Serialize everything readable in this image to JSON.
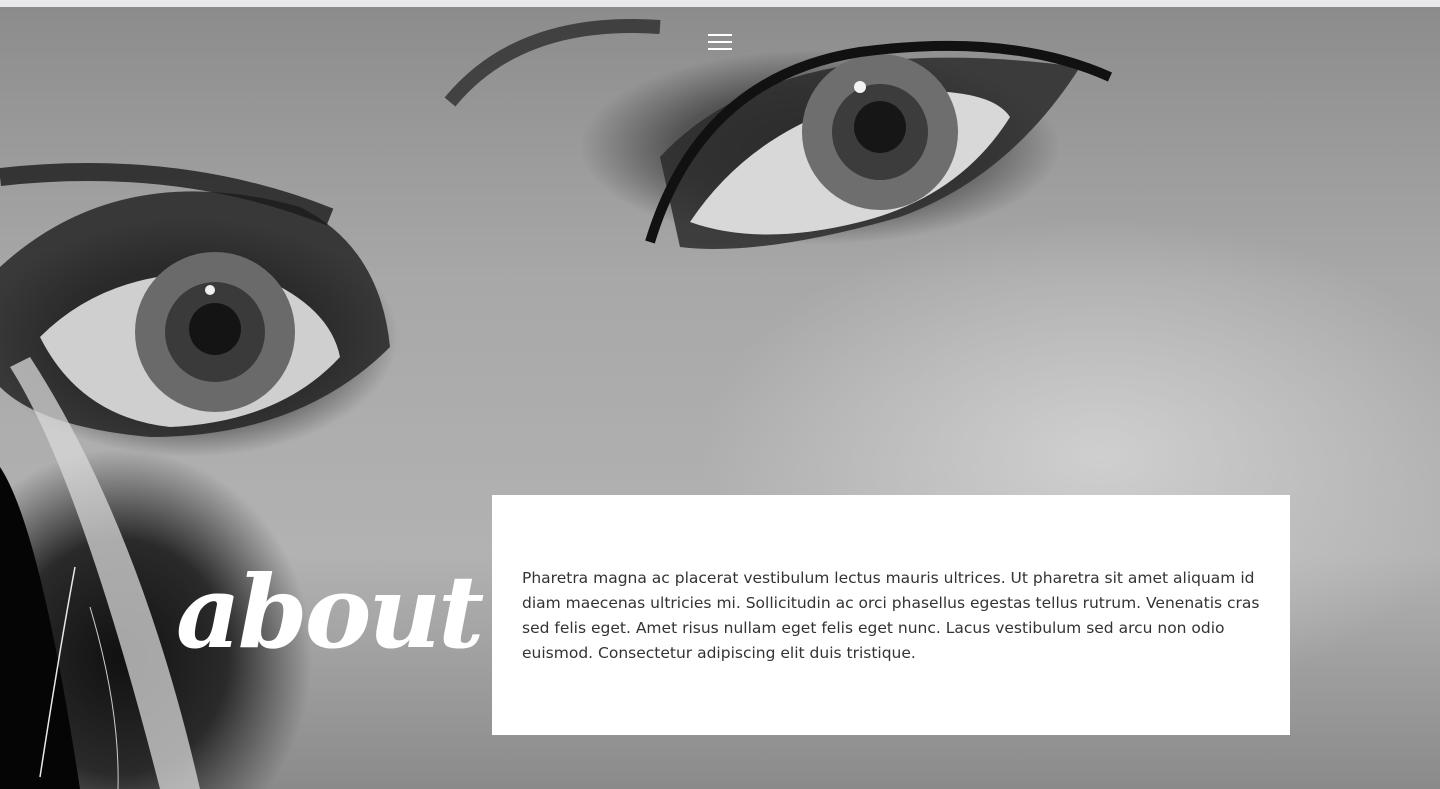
{
  "header": {
    "menu_icon": "hamburger-menu-icon"
  },
  "hero": {
    "background_image": "black-and-white close-up photo of eyes"
  },
  "about": {
    "title": "about",
    "body": "Pharetra magna ac placerat vestibulum lectus mauris ultrices. Ut pharetra sit amet aliquam id diam maecenas ultricies mi. Sollicitudin ac orci phasellus egestas tellus rutrum. Venenatis cras sed felis eget. Amet risus nullam eget felis eget nunc. Lacus vestibulum sed arcu non odio euismod. Consectetur adipiscing elit duis tristique."
  },
  "colors": {
    "card_background": "#ffffff",
    "body_text": "#333333",
    "title_text": "#ffffff",
    "menu_icon": "#ffffff"
  }
}
